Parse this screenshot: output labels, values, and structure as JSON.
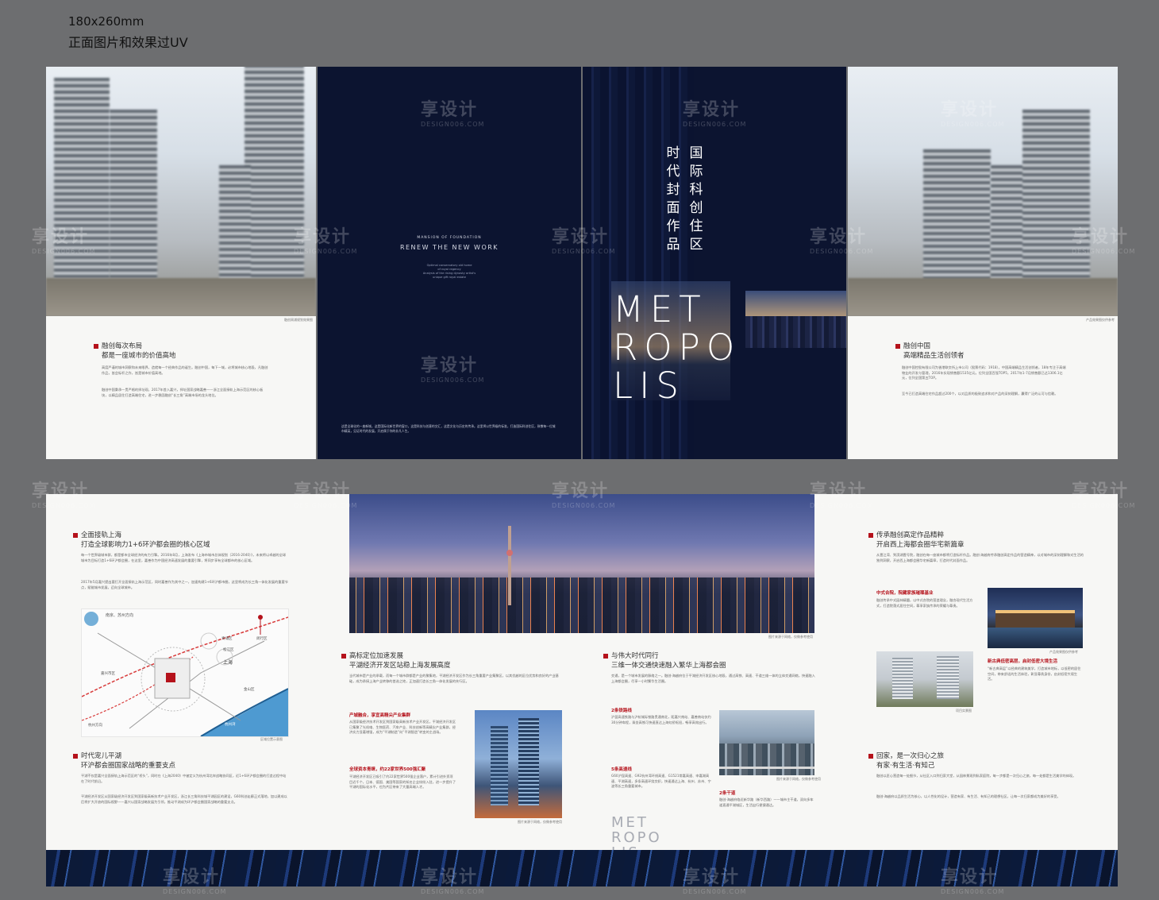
{
  "spec": {
    "size": "180x260mm",
    "note": "正面图片和效果过UV"
  },
  "watermark": {
    "cn": "享设计",
    "en": "DESIGN006.COM"
  },
  "cover_left": {
    "caption": "融创周浦规划效果图",
    "title_line1": "融创每次布局",
    "title_line2": "都是一座城市的价值高地",
    "para1": "高度严谨的城市洞察和未来眼界，造就每一个经典作品的诞生。融创中国，每下一城，必将城市核心地段，凡融创作品，皆会标杆之作，皆是城市价值高地。",
    "para2": "融创中国秉承一贯严格的择址观，2017年首入嘉兴，择址国家战略嘉善——浙江全面接轨上海示范区的核心板块，以精品居住打造高端住宅，进一步稳固融创“长三角”高端市场的龙头地位。"
  },
  "inner_navy": {
    "mansion": "MANSION OF FOUNDATION",
    "renew": "RENEW THE NEW WORK",
    "small1": "Optimal conservatory old home",
    "small2": "of royal regency",
    "small3": "Analysis of the rising dynasty artist's",
    "small4": "unique gift royal estate",
    "bottom_text": "这是全球化的一座新城，这是国际化新世界的窗口，这是科技与创意的交汇，这是文化与历史的传承。这里将以世界级的标准，打造国际科创住区，致敬每一位城市精英，见证时代的发展，开启属于你的非凡人生。"
  },
  "cover_front": {
    "vert_col1": "国际科创住区",
    "vert_col2": "时代封面作品",
    "metro_line1": "MET",
    "metro_line2": "ROPO",
    "metro_line3": "LIS"
  },
  "cover_right": {
    "caption": "产品效果图仅供参考",
    "title_line1": "融创中国",
    "title_line2": "高端精品生活创领者",
    "para1": "融创中国控股有限公司为香港联交所上市公司（股票代码：1918），中国高端精品生活创领者，18年专注于高端物业的开发与管理，2016年实现销售额1535亿元，位列全国百强TOP5，2017年1-7月销售额已达1306.1亿元，位列全国第五TOP。",
    "para2": "至今已打造高端住宅作品超过200个，以对品质的极致追求和对产品的深刻理解，赢得广泛的认可与信赖。"
  },
  "spread": {
    "left_title1_a": "全面接轨上海",
    "left_title1_b": "打造全球影响力1+6环沪都会圈的核心区域",
    "left_para1": "每一个世界级城市群，都是都市全球经济的有力引擎。2016年8月，上海发布《上海市城市总体规划（2016-2040）》，未来将以卓越的全球城市为目标打造1+6环沪都会圈，在这里，嘉善作为中国经济高速发展的重要引擎，将同步享有全球都市的核心区域。",
    "left_para2": "2017年5月嘉兴提出要打开全面接轨上海示范区，同时嘉善作为其中之一，加速构建1+6环沪都市圈，这里将成为长三角一体化发展的重要节点，赋能城市发展，迈向全球城市。",
    "map_labels": {
      "nanjing": "南京、苏州方向",
      "jiaxing": "嘉兴市区",
      "shanghai": "上海",
      "qingpu": "青浦区",
      "minhang": "闵行区",
      "songjiang": "松江区",
      "jinshan": "金山区",
      "hangzhou": "杭州方向",
      "sea": "杭州湾",
      "caption": "区域位置示意图"
    },
    "left_title2_a": "时代宠儿平湖",
    "left_title2_b": "环沪都会圈国家战略的重要支点",
    "left_para3": "平湖不仅是嘉兴全面接轨上海示范区的“桥头”，同时在《上海2040》中被定义为杭州湾北岸战略协同区，近1+6环沪都会圈的打造过程中站在了时代前沿。",
    "left_para4": "平湖经济开发区从国家级经济开发区到国家级高新技术产业开发区，浙江长三角科技城平湖园区的建设，G60科创走廊正式落地，加以建成以后将扩大开放的国际视野——嘉兴以国家战略发展为引领，推动平湖成为环沪都会圈国家战略的重要支点。",
    "mid_caption": "图片来源于网络，仅做参考使用",
    "mid_title1_a": "高标定位加速发展",
    "mid_title1_b": "平湖经济开发区站稳上海发展高度",
    "mid_para1": "当代城市是产业的承载，而每一个城市群都是产业的聚集地，平湖经济开发区作为长三角重要产业集聚区，以其优越的区位优势和良好的产业基础，成为承接上海产业转移的首选之地，正加速打造长三角一体化发展的先行区。",
    "red1": "产城融合，享宜高精尖产业集群",
    "mid_para2": "从国家级经济技术开发区到国家级高新技术产业开发区，平湖经济开发区已集聚了光机电、生物医药、汽车产业、科技创新等高精尖产业集群，经济实力显著增强，成为“平湖制造”向“平湖智造”转变的主战场。",
    "red2": "全球资本青睐，约22家世界500强汇聚",
    "mid_para3": "平湖经济开发区已吸引了约22家世界500强企业落户，累计引进外资项目近千个，日本、德国、美国等国家的知名企业纷纷入驻，进一步提升了平湖的国际化水平，也为片区带来了大量高端人才。",
    "mid_caption2": "图片来源于网络，仅做参考使用",
    "mid_title2_a": "与伟大时代同行",
    "mid_title2_b": "三维一体交通快速融入繁华上海都会圈",
    "mid_para4": "交通，是一个城市发展的脉络之一。融创·海越府位于平湖经济开发区核心地段，通过高铁、高速、干道三维一体的立体交通网络，快速融入上海都会圈，尽享一小时繁华生活圈。",
    "red3": "2条铁路线",
    "mid_para5": "沪昆高速铁路与沪杭城际铁路贯通南北，距嘉兴南站、嘉善南站仅约30分钟车程，乘坐高铁可快速直达上海虹桥枢纽，畅享高效出行。",
    "red4": "5条高速线",
    "mid_para6": "G60沪昆高速、G92杭州湾环线高速、G1521常嘉高速、申嘉湖高速、平湖高速，多条高速环绕交织，快速通达上海、杭州、苏州、宁波等长三角重要城市。",
    "red5": "2条干道",
    "mid_para7": "融创·海越府临近新华路（新华西路）——城市主干道，双向多车道直通平湖城区，生活出行便捷通达。",
    "mid_caption3": "图片来源于网络，仅做参考使用",
    "metro_footer": [
      "MET",
      "ROPO",
      "LIS"
    ],
    "right_title1_a": "传承融创高定作品精粹",
    "right_title1_b": "开启西上海都会圈华宅新篇章",
    "right_para1": "从壹江湾、到滨湖壹号院，融创在每一座城市都将打造标杆作品。融创·海越府传承融创高定作品的营造精神，以对城市的深刻理解和对生活的独到洞察，开启西上海都会圈华宅新篇章，打造时代封面作品。",
    "red6": "中式合院，院藏家族璀璨基业",
    "right_para2": "融创传承中式园林精髓，以中式合院的营造理念，融合现代生活方式，打造院落式居住空间，尊享家族传承的荣耀与尊贵。",
    "right_caption1": "产品效果图仅供参考",
    "right_caption2": "项目实景图",
    "red7": "新古典低密高层，启封低密大境生活",
    "right_para3": "“新古典高层”以经典的建筑美学，打造城市地标，以低密的居住空间，带来舒适的生活体验，彰显尊贵身份，启封低密大境生活。",
    "right_title2_a": "回家，是一次归心之旅",
    "right_title2_b": "有家·有生活·有知己",
    "right_para4": "融创以匠心营造每一处细节，从社区入口到归家大堂，从园林景观到私家庭院，每一步都是一次归心之旅，每一处都是生活美学的体现。",
    "right_para5": "融创·海越府以品质生活为核心，以人性化的设计，营造有家、有生活、有知己的理想社区，让每一次归家都成为美好的享受。"
  }
}
